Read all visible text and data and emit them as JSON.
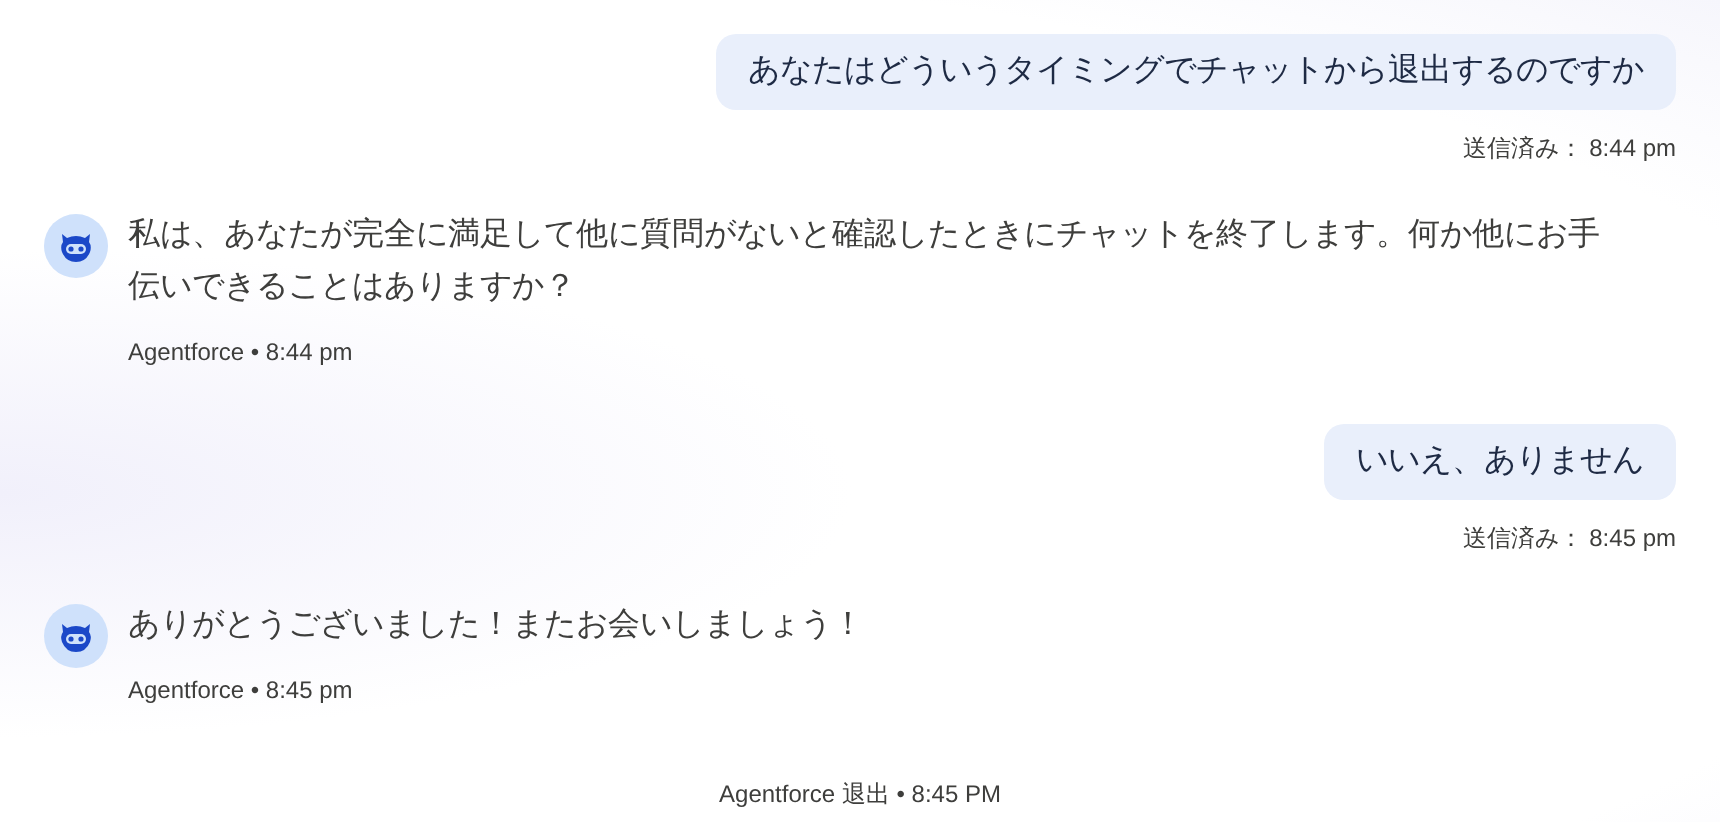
{
  "messages": [
    {
      "kind": "user",
      "text": "あなたはどういうタイミングでチャットから退出するのですか",
      "meta": "送信済み： 8:44 pm"
    },
    {
      "kind": "agent",
      "text": "私は、あなたが完全に満足して他に質問がないと確認したときにチャットを終了します。何か他にお手伝いできることはありますか？",
      "meta": "Agentforce • 8:44 pm"
    },
    {
      "kind": "user",
      "text": "いいえ、ありません",
      "meta": "送信済み： 8:45 pm"
    },
    {
      "kind": "agent",
      "text": "ありがとうございました！またお会いしましょう！",
      "meta": "Agentforce • 8:45 pm"
    },
    {
      "kind": "event",
      "text": "Agentforce 退出 • 8:45 PM"
    }
  ]
}
